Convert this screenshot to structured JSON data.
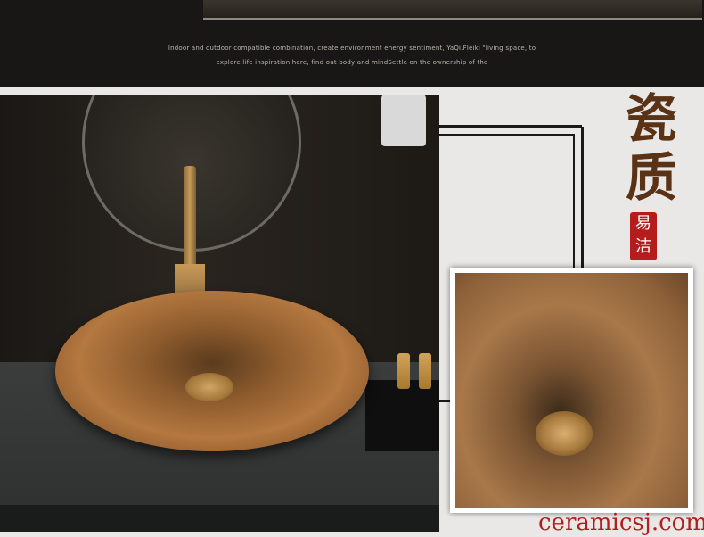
{
  "banner": {
    "line1": "Indoor and outdoor compatible combination, create environment  energy sentiment, YaQi.Fleiki \"living space, to",
    "line2": "explore life inspiration here, find out body and mindSettle on the ownership of the"
  },
  "title": {
    "char1": "瓷",
    "char2": "质"
  },
  "seal": {
    "line1": "易",
    "line2": "洁"
  },
  "watermark": "ceramicsj.com"
}
